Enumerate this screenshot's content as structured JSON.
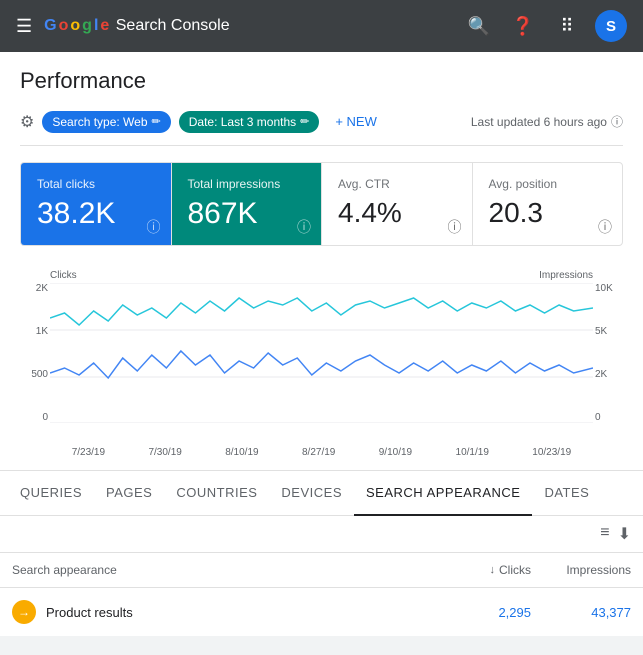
{
  "header": {
    "logo": "Google Search Console",
    "avatar_letter": "S"
  },
  "page": {
    "title": "Performance"
  },
  "filter_bar": {
    "chip1_label": "Search type: Web",
    "chip2_label": "Date: Last 3 months",
    "new_label": "+ NEW",
    "last_updated": "Last updated 6 hours ago"
  },
  "metrics": [
    {
      "label": "Total clicks",
      "value": "38.2K",
      "type": "blue"
    },
    {
      "label": "Total impressions",
      "value": "867K",
      "type": "teal"
    },
    {
      "label": "Avg. CTR",
      "value": "4.4%",
      "type": "white"
    },
    {
      "label": "Avg. position",
      "value": "20.3",
      "type": "white"
    }
  ],
  "chart": {
    "y_left_label": "Clicks",
    "y_right_label": "Impressions",
    "y_left_values": [
      "2K",
      "1K",
      "500",
      "0"
    ],
    "y_right_values": [
      "10K",
      "5K",
      "2K",
      "0"
    ],
    "x_labels": [
      "7/23/19",
      "7/30/19",
      "8/10/19",
      "8/27/19",
      "9/10/19",
      "10/1/19",
      "10/23/19"
    ]
  },
  "tabs": [
    {
      "id": "queries",
      "label": "QUERIES",
      "active": false
    },
    {
      "id": "pages",
      "label": "PAGES",
      "active": false
    },
    {
      "id": "countries",
      "label": "COUNTRIES",
      "active": false
    },
    {
      "id": "devices",
      "label": "DEVICES",
      "active": false
    },
    {
      "id": "search_appearance",
      "label": "SEARCH APPEARANCE",
      "active": true
    },
    {
      "id": "dates",
      "label": "DATES",
      "active": false
    }
  ],
  "table": {
    "col_name": "Search appearance",
    "col_clicks": "Clicks",
    "col_impressions": "Impressions",
    "rows": [
      {
        "name": "Product results",
        "clicks": "2,295",
        "impressions": "43,377"
      }
    ]
  }
}
